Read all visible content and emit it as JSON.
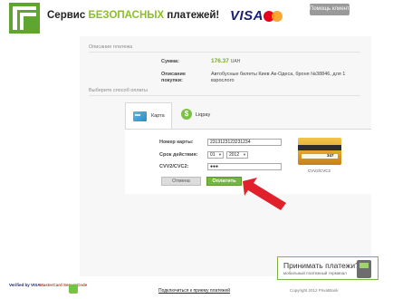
{
  "header": {
    "title_prefix": "Сервис ",
    "title_accent": "БЕЗОПАСНЫХ",
    "title_suffix": " платежей!",
    "visa_label": "VISA",
    "help_button": "Помощь клиенту"
  },
  "payment_info": {
    "section_title": "Описание платежа",
    "amount_label": "Сумма:",
    "amount_value": "176.37",
    "amount_currency": "UAH",
    "description_label": "Описание покупки:",
    "description_value": "Автобусные билеты Киев Ак-Одеса, броня №38846, для 1 взрослого"
  },
  "payment_method": {
    "section_title": "Выберите способ оплаты",
    "tabs": [
      {
        "label": "Карта",
        "active": true
      },
      {
        "label": "Liqpay",
        "active": false
      }
    ]
  },
  "form": {
    "card_number_label": "Номер карты:",
    "card_number_value": "2313123123231234",
    "expiry_label": "Срок действия:",
    "expiry_month": "01",
    "expiry_year": "2012",
    "cvv_label": "CVV2/CVC2:",
    "cvv_value": "●●●",
    "cancel_button": "Отмена",
    "pay_button": "Оплатить",
    "card_cvv_sample": "347",
    "card_caption": "CVV2/CVC2"
  },
  "banner": {
    "title": "Принимать платежи?",
    "subtitle": "мобильный платежный терминал"
  },
  "footer": {
    "logo_verified": "Verified by VISA",
    "logo_mastercard": "MasterCard SecureCode",
    "link": "Подключиться к приему платежей",
    "copyright": "Copyright 2012 PrivatBank"
  },
  "colors": {
    "accent_green": "#8cbf26",
    "pay_button": "#74b73c",
    "arrow_red": "#e0202a"
  }
}
